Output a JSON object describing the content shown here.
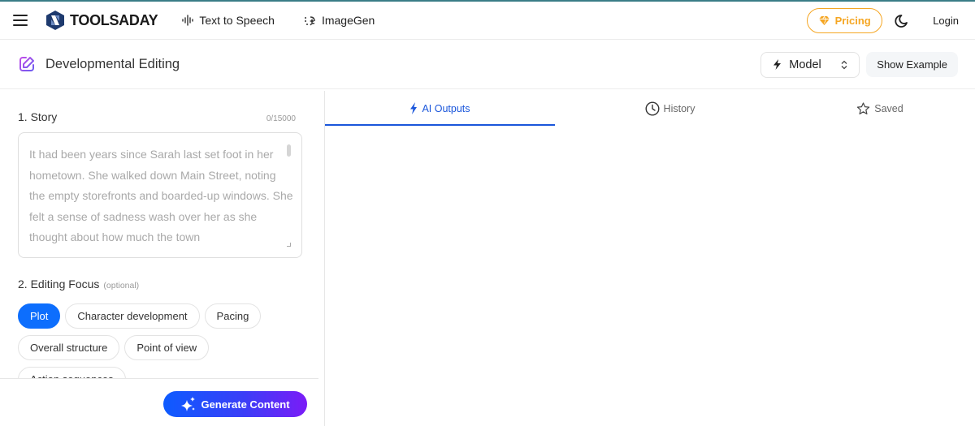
{
  "nav": {
    "brand": "TOOLSADAY",
    "links": [
      {
        "label": "Text to Speech",
        "icon": "waveform-icon"
      },
      {
        "label": "ImageGen",
        "icon": "sparkle-dots-icon"
      }
    ],
    "pricing_label": "Pricing",
    "login_label": "Login"
  },
  "tool": {
    "title": "Developmental Editing",
    "model_label": "Model",
    "show_example_label": "Show Example"
  },
  "form": {
    "story": {
      "label": "1. Story",
      "counter": "0/15000",
      "placeholder": "It had been years since Sarah last set foot in her hometown. She walked down Main Street, noting the empty storefronts and boarded-up windows. She felt a sense of sadness wash over her as she thought about how much the town"
    },
    "focus": {
      "label": "2. Editing Focus",
      "optional": "(optional)",
      "chips": [
        {
          "label": "Plot",
          "active": true
        },
        {
          "label": "Character development",
          "active": false
        },
        {
          "label": "Pacing",
          "active": false
        },
        {
          "label": "Overall structure",
          "active": false
        },
        {
          "label": "Point of view",
          "active": false
        },
        {
          "label": "Action sequences",
          "active": false
        }
      ]
    },
    "generate_label": "Generate Content"
  },
  "tabs": [
    {
      "label": "AI Outputs",
      "icon": "bolt-icon",
      "active": true
    },
    {
      "label": "History",
      "icon": "clock-icon",
      "active": false
    },
    {
      "label": "Saved",
      "icon": "star-icon",
      "active": false
    }
  ],
  "colors": {
    "accent": "#0d6efd",
    "pricing": "#f5a623",
    "tab_active": "#1a56db"
  }
}
